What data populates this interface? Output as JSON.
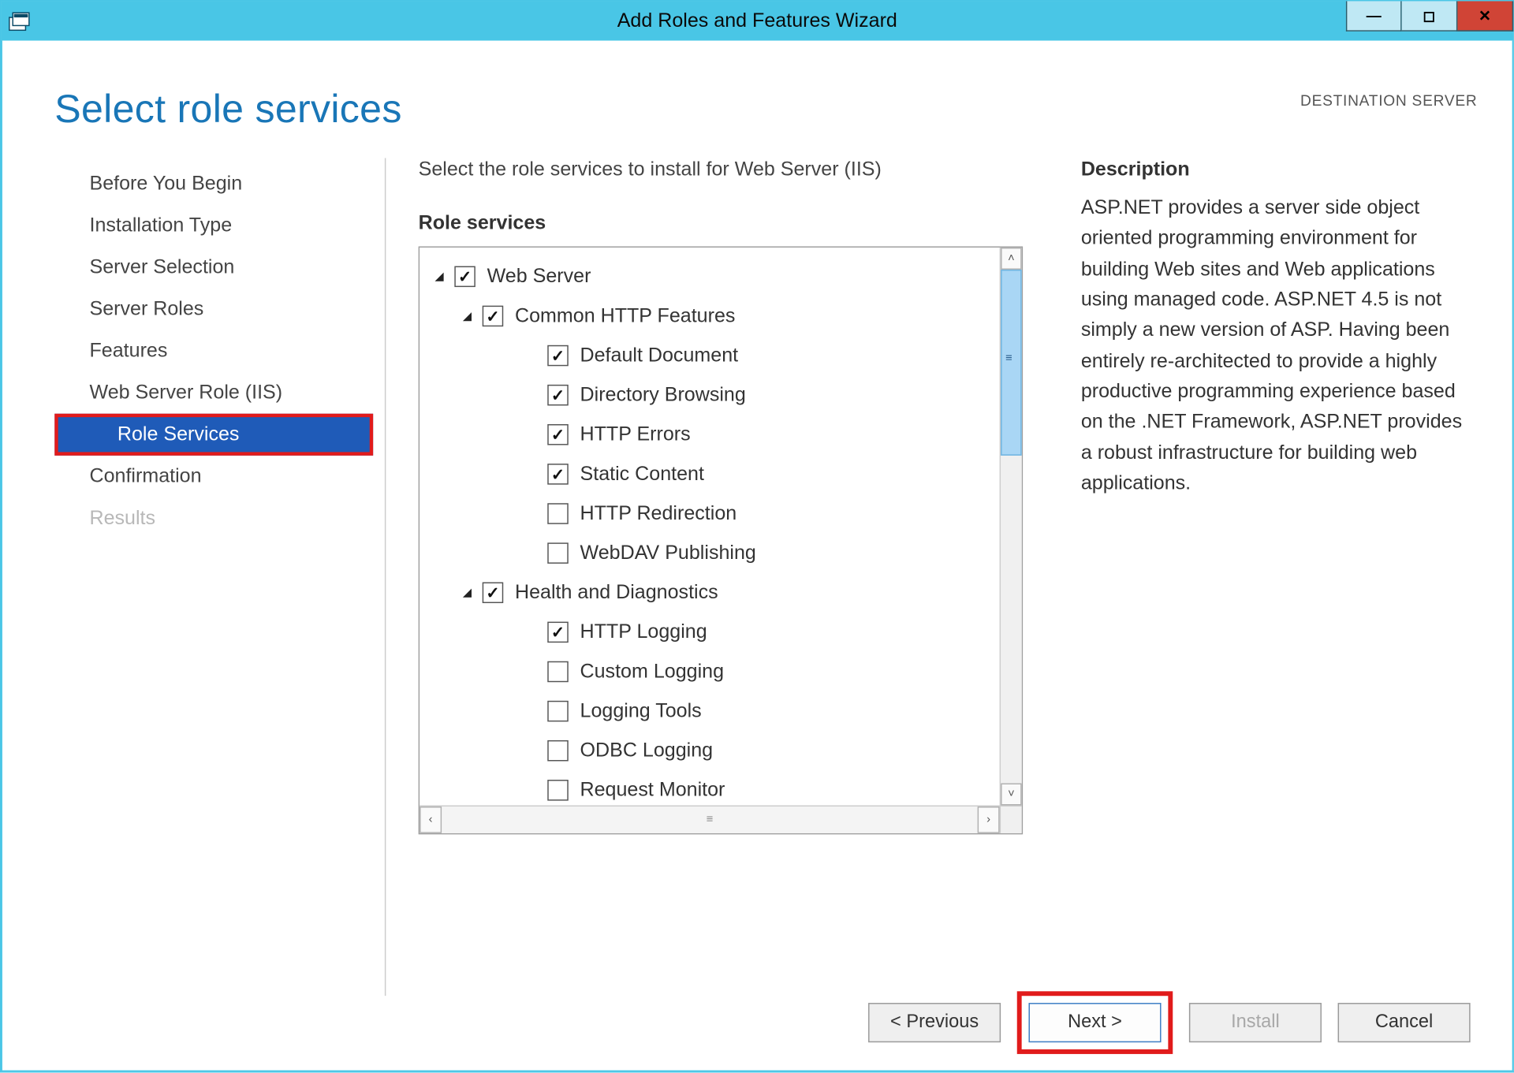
{
  "window": {
    "title": "Add Roles and Features Wizard"
  },
  "header": {
    "page_title": "Select role services",
    "dest_label": "DESTINATION SERVER",
    "dest_name": ""
  },
  "sidebar": {
    "steps": [
      {
        "label": "Before You Begin"
      },
      {
        "label": "Installation Type"
      },
      {
        "label": "Server Selection"
      },
      {
        "label": "Server Roles"
      },
      {
        "label": "Features"
      },
      {
        "label": "Web Server Role (IIS)"
      },
      {
        "label": "Role Services"
      },
      {
        "label": "Confirmation"
      },
      {
        "label": "Results"
      }
    ]
  },
  "main": {
    "instruction": "Select the role services to install for Web Server (IIS)",
    "tree_label": "Role services",
    "desc_label": "Description",
    "desc_text": "ASP.NET provides a server side object oriented programming environment for building Web sites and Web applications using managed code. ASP.NET 4.5 is not simply a new version of ASP. Having been entirely re-architected to provide a highly productive programming experience based on the .NET Framework, ASP.NET provides a robust infrastructure for building web applications.",
    "tree": [
      {
        "indent": 0,
        "expander": true,
        "checked": true,
        "label": "Web Server"
      },
      {
        "indent": 1,
        "expander": true,
        "checked": true,
        "label": "Common HTTP Features"
      },
      {
        "indent": 2,
        "expander": false,
        "checked": true,
        "label": "Default Document"
      },
      {
        "indent": 2,
        "expander": false,
        "checked": true,
        "label": "Directory Browsing"
      },
      {
        "indent": 2,
        "expander": false,
        "checked": true,
        "label": "HTTP Errors"
      },
      {
        "indent": 2,
        "expander": false,
        "checked": true,
        "label": "Static Content"
      },
      {
        "indent": 2,
        "expander": false,
        "checked": false,
        "label": "HTTP Redirection"
      },
      {
        "indent": 2,
        "expander": false,
        "checked": false,
        "label": "WebDAV Publishing"
      },
      {
        "indent": 1,
        "expander": true,
        "checked": true,
        "label": "Health and Diagnostics"
      },
      {
        "indent": 2,
        "expander": false,
        "checked": true,
        "label": "HTTP Logging"
      },
      {
        "indent": 2,
        "expander": false,
        "checked": false,
        "label": "Custom Logging"
      },
      {
        "indent": 2,
        "expander": false,
        "checked": false,
        "label": "Logging Tools"
      },
      {
        "indent": 2,
        "expander": false,
        "checked": false,
        "label": "ODBC Logging"
      },
      {
        "indent": 2,
        "expander": false,
        "checked": false,
        "label": "Request Monitor"
      }
    ]
  },
  "footer": {
    "previous": "< Previous",
    "next": "Next >",
    "install": "Install",
    "cancel": "Cancel"
  }
}
